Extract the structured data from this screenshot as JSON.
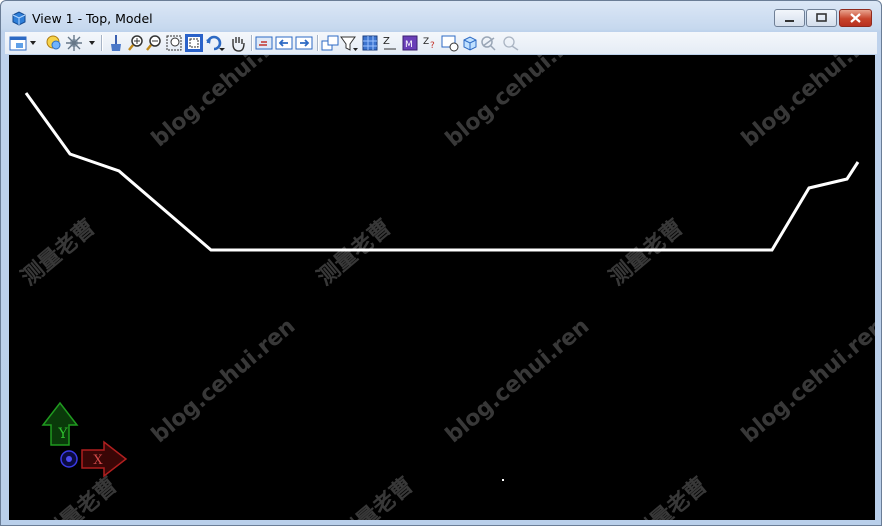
{
  "window": {
    "title": "View 1 - Top, Model"
  },
  "toolbar": {
    "buttons": [
      "view-attributes",
      "levels-display",
      "display-style",
      "update-view",
      "zoom-in",
      "zoom-out",
      "window-area",
      "fit-view",
      "rotate-view",
      "pan-view",
      "view-previous",
      "view-next",
      "copy-view",
      "clip-volume",
      "render",
      "change-view-perspective",
      "standard-views",
      "camera",
      "fit-sheet",
      "cube-view",
      "clip-mask",
      "clip-mask-off"
    ]
  },
  "viewport": {
    "background": "#000000",
    "line_color": "#ffffff",
    "watermark_url": "blog.cehui.ren",
    "watermark_cn": "测量老曹",
    "axis": {
      "y_label": "Y",
      "x_label": "X",
      "y_color": "#1a8a1a",
      "x_color": "#8a1a1a",
      "origin_color": "#2b2bd9"
    }
  }
}
